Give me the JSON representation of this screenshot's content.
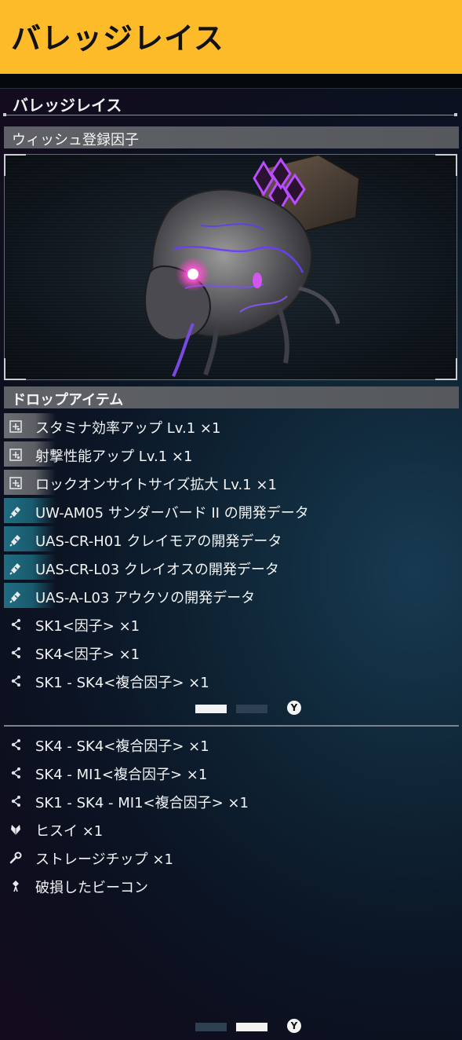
{
  "header": {
    "title": "バレッジレイス"
  },
  "section": {
    "title": "バレッジレイス"
  },
  "wish_band": {
    "label": "ウィッシュ登録因子"
  },
  "drop_band": {
    "label": "ドロップアイテム"
  },
  "page1_items": [
    {
      "label": "スタミナ効率アップ Lv.1 ×1",
      "icon": "chip-module-icon",
      "style": "grey"
    },
    {
      "label": "射撃性能アップ Lv.1 ×1",
      "icon": "chip-module-icon",
      "style": "grey"
    },
    {
      "label": "ロックオンサイトサイズ拡大 Lv.1 ×1",
      "icon": "chip-module-icon",
      "style": "grey"
    },
    {
      "label": "UW-AM05 サンダーバード II の開発データ",
      "icon": "blueprint-data-icon",
      "style": "teal"
    },
    {
      "label": "UAS-CR-H01 クレイモアの開発データ",
      "icon": "blueprint-data-icon",
      "style": "teal"
    },
    {
      "label": "UAS-CR-L03 クレイオスの開発データ",
      "icon": "blueprint-data-icon",
      "style": "teal"
    },
    {
      "label": "UAS-A-L03 アウクソの開発データ",
      "icon": "blueprint-data-icon",
      "style": "teal"
    },
    {
      "label": "SK1<因子> ×1",
      "icon": "factor-icon",
      "style": "plain"
    },
    {
      "label": "SK4<因子> ×1",
      "icon": "factor-icon",
      "style": "plain"
    },
    {
      "label": "SK1 - SK4<複合因子> ×1",
      "icon": "factor-icon",
      "style": "plain"
    }
  ],
  "page2_items": [
    {
      "label": "SK4 - SK4<複合因子> ×1",
      "icon": "factor-icon",
      "style": "plain"
    },
    {
      "label": "SK4 - MI1<複合因子> ×1",
      "icon": "factor-icon",
      "style": "plain"
    },
    {
      "label": "SK1 - SK4 - MI1<複合因子> ×1",
      "icon": "factor-icon",
      "style": "plain"
    },
    {
      "label": "ヒスイ ×1",
      "icon": "jade-crystal-icon",
      "style": "plain"
    },
    {
      "label": "ストレージチップ ×1",
      "icon": "wrench-icon",
      "style": "plain"
    },
    {
      "label": "破損したビーコン",
      "icon": "beacon-icon",
      "style": "plain"
    }
  ],
  "pager1": {
    "active_page": 1,
    "total_pages": 2,
    "button": "Y"
  },
  "pager2": {
    "active_page": 2,
    "total_pages": 2,
    "button": "Y"
  },
  "colors": {
    "header_bg": "#fdbb2a",
    "teal_highlight": "#1f6d84",
    "grey_highlight": "#6a6d72"
  }
}
